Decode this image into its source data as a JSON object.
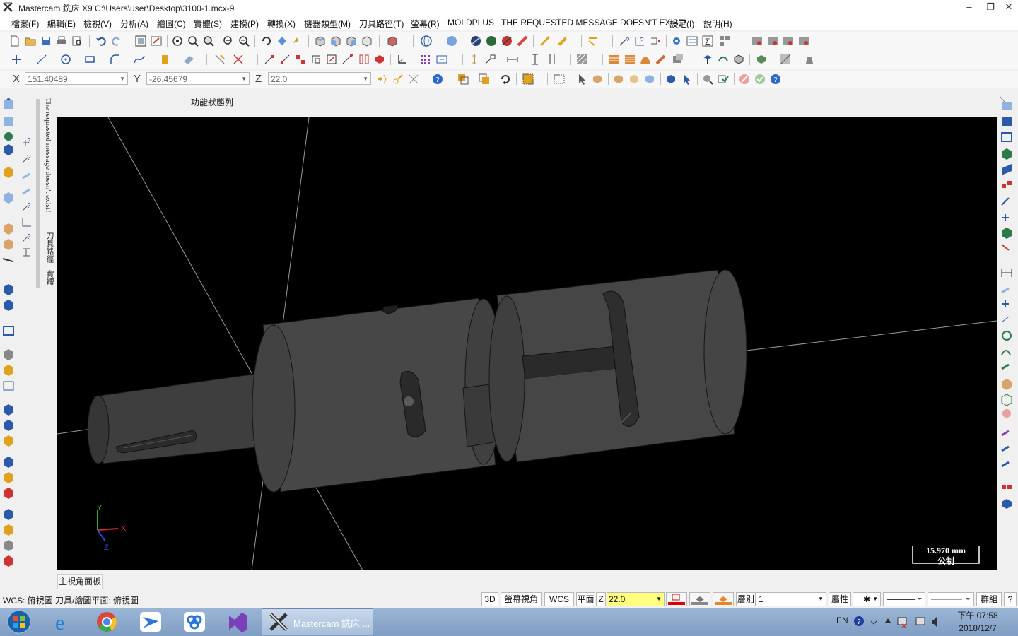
{
  "window": {
    "title": "Mastercam 銑床 X9  C:\\Users\\user\\Desktop\\3100-1.mcx-9",
    "minimize": "–",
    "restore": "❐",
    "close": "✕"
  },
  "menu": [
    "檔案(F)",
    "編輯(E)",
    "檢視(V)",
    "分析(A)",
    "繪圖(C)",
    "實體(S)",
    "建模(P)",
    "轉換(X)",
    "機器類型(M)",
    "刀具路徑(T)",
    "螢幕(R)",
    "MOLDPLUS",
    "THE REQUESTED MESSAGE DOESN'T EXIST!",
    "設定(I)",
    "說明(H)"
  ],
  "coords": {
    "x_label": "X",
    "x_value": "151.40489",
    "y_label": "Y",
    "y_value": "-26.45679",
    "z_label": "Z",
    "z_value": "22.0"
  },
  "left_panel": {
    "vtab_message": "The requested message doesn't exist!",
    "vtab_toolpath": "刀具路徑",
    "vtab_solid": "實體"
  },
  "function_status_label": "功能狀態列",
  "viewport": {
    "axis_x": "X",
    "axis_y": "Y",
    "axis_z": "Z",
    "scale_value": "15.970 mm",
    "scale_unit": "公制"
  },
  "bottom_tab": "主視角面板",
  "status": {
    "text": "WCS: 俯視圖  刀具/繪圖平面: 俯視圖",
    "btn_3d": "3D",
    "btn_screen_view": "螢幕視角",
    "btn_wcs": "WCS",
    "btn_plane": "平面",
    "z_label": "Z",
    "z_value": "22.0",
    "layer_label": "層別",
    "layer_value": "1",
    "attributes": "屬性",
    "group": "群組",
    "help": "?"
  },
  "taskbar": {
    "active_app": "Mastercam 銑床 ...",
    "lang": "EN",
    "time": "下午 07:58",
    "date": "2018/12/7"
  }
}
